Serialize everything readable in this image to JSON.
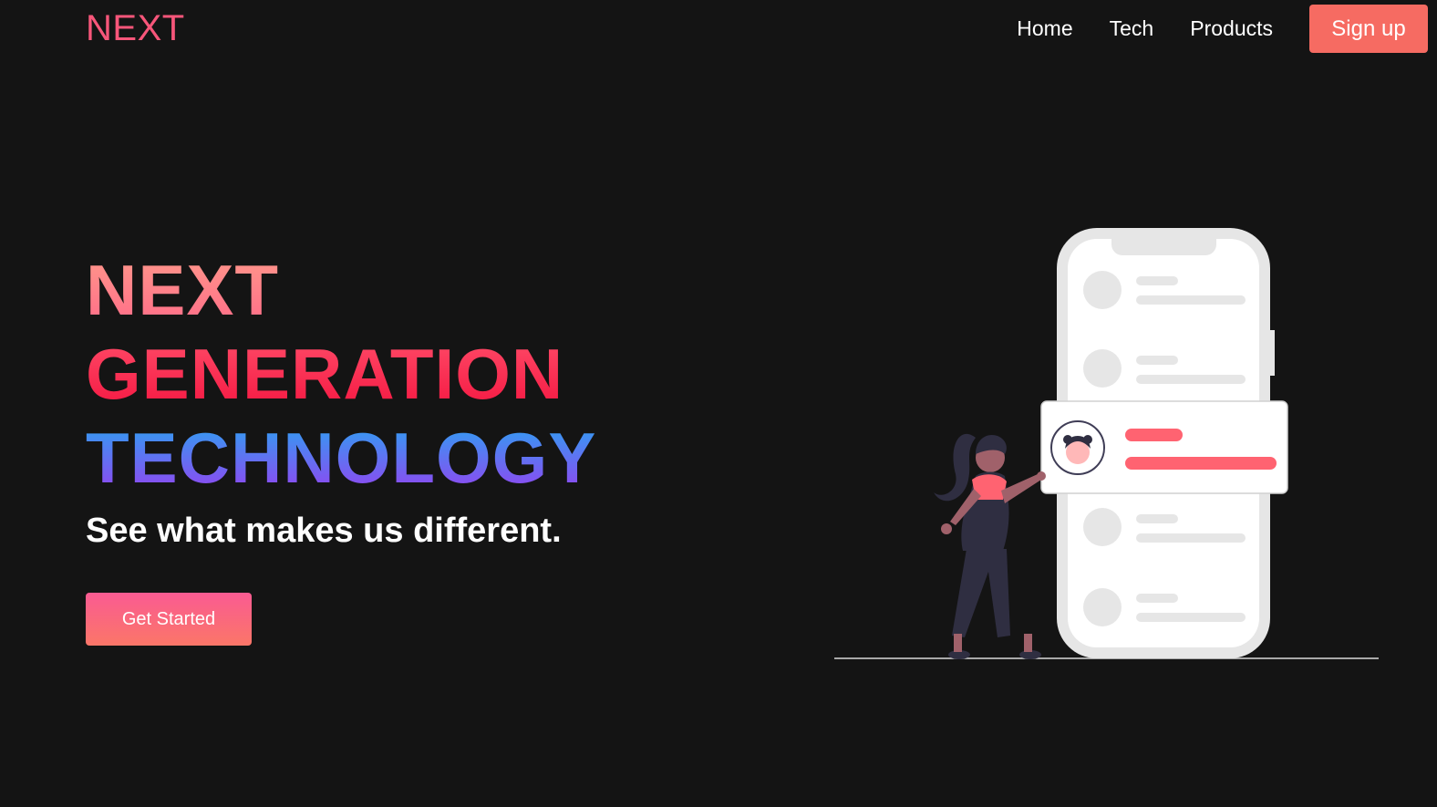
{
  "nav": {
    "logo": "NEXT",
    "links": [
      "Home",
      "Tech",
      "Products"
    ],
    "signup": "Sign up"
  },
  "hero": {
    "line1": "NEXT",
    "line2": "GENERATION",
    "line3": "TECHNOLOGY",
    "subtitle": "See what makes us different.",
    "cta": "Get Started"
  },
  "colors": {
    "background": "#141414",
    "accent": "#f66b62",
    "logo": "#f7567a"
  },
  "illustration": {
    "subject": "woman-with-phone-illustration"
  }
}
